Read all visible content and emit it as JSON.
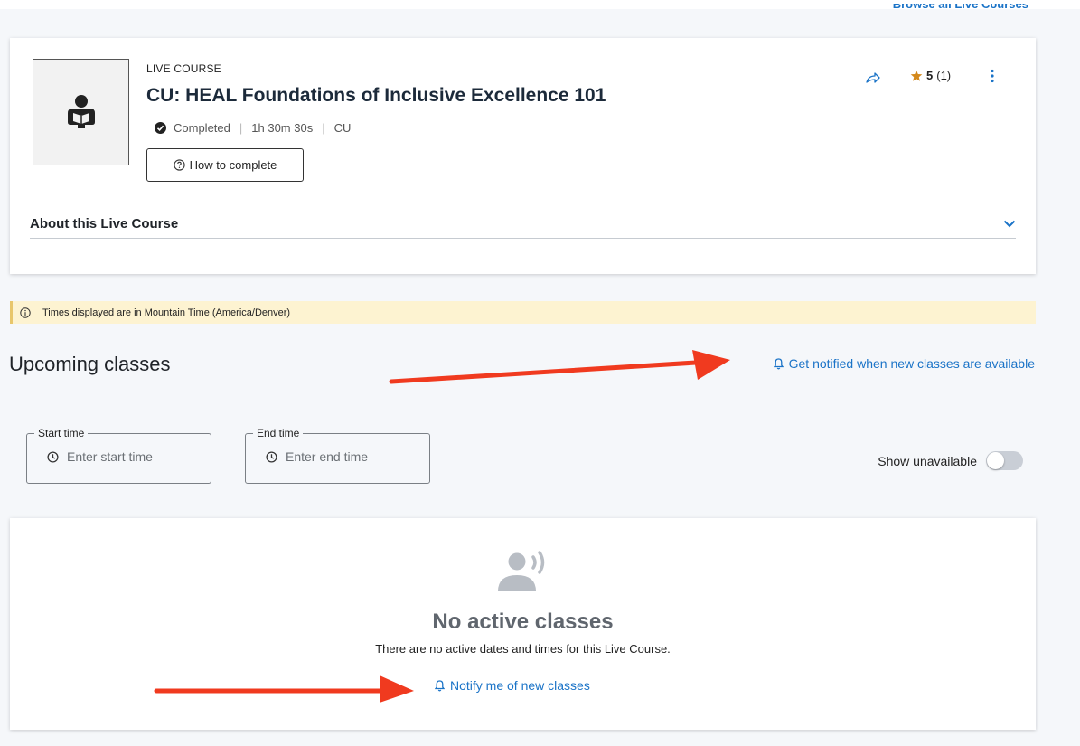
{
  "header": {
    "browse_link": "Browse all Live Courses"
  },
  "course": {
    "type_label": "LIVE COURSE",
    "title": "CU: HEAL Foundations of Inclusive Excellence 101",
    "status": "Completed",
    "duration": "1h 30m 30s",
    "provider": "CU",
    "how_to_complete": "How to complete",
    "rating_score": "5",
    "rating_count": "(1)",
    "about_label": "About this Live Course"
  },
  "timezone_notice": "Times displayed are in Mountain Time (America/Denver)",
  "upcoming": {
    "title": "Upcoming classes",
    "notify_link": "Get notified when new classes are available"
  },
  "filters": {
    "start_label": "Start time",
    "start_placeholder": "Enter start time",
    "end_label": "End time",
    "end_placeholder": "Enter end time",
    "show_unavailable": "Show unavailable",
    "show_unavailable_on": false
  },
  "empty_state": {
    "title": "No active classes",
    "subtitle": "There are no active dates and times for this Live Course.",
    "notify_link": "Notify me of new classes"
  },
  "colors": {
    "link": "#1a73c7",
    "star": "#d4891c",
    "annotation_arrow": "#f03a1f",
    "banner_bg": "#fdf3d1"
  },
  "icons": {
    "thumbnail": "person-reading-icon",
    "status": "check-circle-icon",
    "help": "help-circle-icon",
    "share": "share-arrow-icon",
    "rating": "star-icon",
    "more": "more-vertical-icon",
    "expand": "chevron-down-icon",
    "info": "info-icon",
    "bell": "bell-icon",
    "clock": "clock-icon",
    "empty": "person-speaking-icon"
  }
}
